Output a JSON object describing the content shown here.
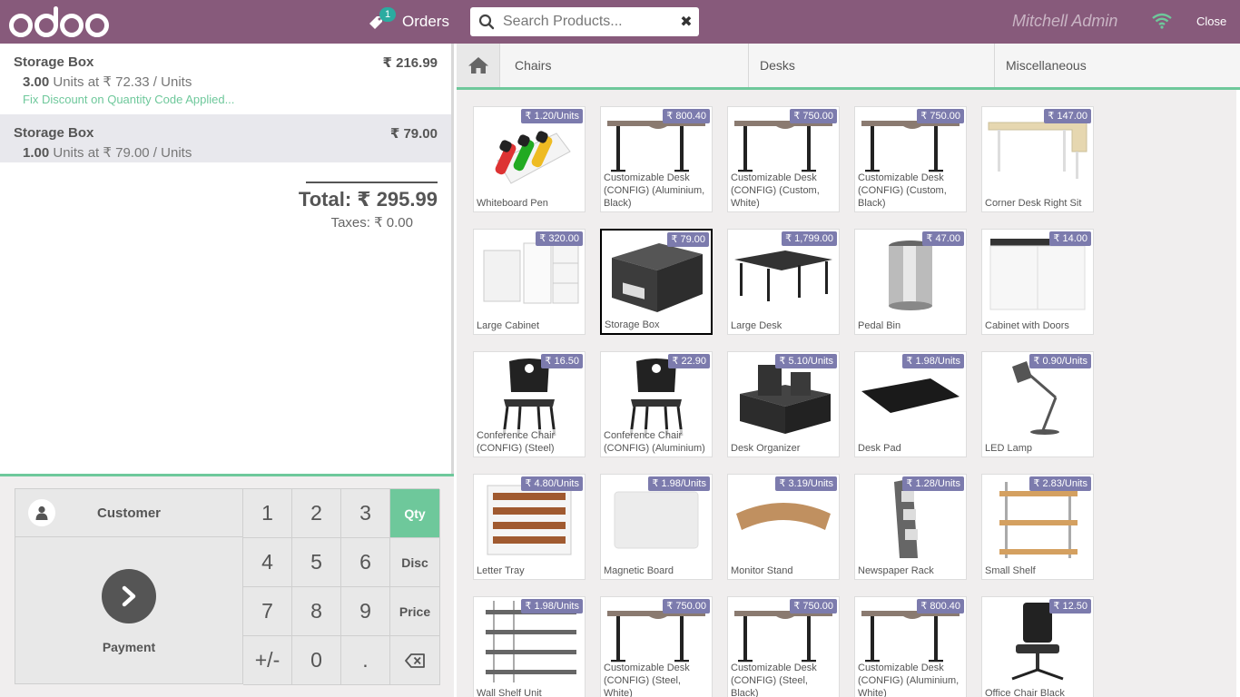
{
  "header": {
    "orders_label": "Orders",
    "orders_count": "1",
    "search_placeholder": "Search Products...",
    "user_name": "Mitchell Admin",
    "close_label": "Close"
  },
  "order": {
    "lines": [
      {
        "name": "Storage Box",
        "price": "₹ 216.99",
        "qty": "3.00",
        "unit_text": "Units at ₹ 72.33 / Units",
        "note": "Fix Discount on Quantity Code Applied..."
      },
      {
        "name": "Storage Box",
        "price": "₹ 79.00",
        "qty": "1.00",
        "unit_text": "Units at ₹ 79.00 / Units"
      }
    ],
    "total_label": "Total: ₹ 295.99",
    "taxes_label": "Taxes: ₹ 0.00"
  },
  "pad": {
    "customer_label": "Customer",
    "payment_label": "Payment",
    "keys": [
      "1",
      "2",
      "3",
      "Qty",
      "4",
      "5",
      "6",
      "Disc",
      "7",
      "8",
      "9",
      "Price",
      "+/-",
      "0",
      "."
    ],
    "active_mode": "Qty"
  },
  "categories": [
    "Chairs",
    "Desks",
    "Miscellaneous"
  ],
  "products": [
    {
      "name": "Whiteboard Pen",
      "price": "₹ 1.20/Units",
      "icon": "pen-icon"
    },
    {
      "name": "Customizable Desk (CONFIG) (Aluminium, Black)",
      "price": "₹ 800.40",
      "icon": "desk-icon"
    },
    {
      "name": "Customizable Desk (CONFIG) (Custom, White)",
      "price": "₹ 750.00",
      "icon": "desk-icon"
    },
    {
      "name": "Customizable Desk (CONFIG) (Custom, Black)",
      "price": "₹ 750.00",
      "icon": "desk-icon"
    },
    {
      "name": "Corner Desk Right Sit",
      "price": "₹ 147.00",
      "icon": "corner-desk-icon"
    },
    {
      "name": "Large Cabinet",
      "price": "₹ 320.00",
      "icon": "cabinet-icon"
    },
    {
      "name": "Storage Box",
      "price": "₹ 79.00",
      "icon": "box-icon"
    },
    {
      "name": "Large Desk",
      "price": "₹ 1,799.00",
      "icon": "large-desk-icon"
    },
    {
      "name": "Pedal Bin",
      "price": "₹ 47.00",
      "icon": "bin-icon"
    },
    {
      "name": "Cabinet with Doors",
      "price": "₹ 14.00",
      "icon": "cabinet-doors-icon"
    },
    {
      "name": "Conference Chair (CONFIG) (Steel)",
      "price": "₹ 16.50",
      "icon": "chair-icon"
    },
    {
      "name": "Conference Chair (CONFIG) (Aluminium)",
      "price": "₹ 22.90",
      "icon": "chair-icon"
    },
    {
      "name": "Desk Organizer",
      "price": "₹ 5.10/Units",
      "icon": "organizer-icon"
    },
    {
      "name": "Desk Pad",
      "price": "₹ 1.98/Units",
      "icon": "pad-icon"
    },
    {
      "name": "LED Lamp",
      "price": "₹ 0.90/Units",
      "icon": "lamp-icon"
    },
    {
      "name": "Letter Tray",
      "price": "₹ 4.80/Units",
      "icon": "tray-icon"
    },
    {
      "name": "Magnetic Board",
      "price": "₹ 1.98/Units",
      "icon": "board-icon"
    },
    {
      "name": "Monitor Stand",
      "price": "₹ 3.19/Units",
      "icon": "stand-icon"
    },
    {
      "name": "Newspaper Rack",
      "price": "₹ 1.28/Units",
      "icon": "rack-icon"
    },
    {
      "name": "Small Shelf",
      "price": "₹ 2.83/Units",
      "icon": "shelf-icon"
    },
    {
      "name": "Wall Shelf Unit",
      "price": "₹ 1.98/Units",
      "icon": "wall-shelf-icon"
    },
    {
      "name": "Customizable Desk (CONFIG) (Steel, White)",
      "price": "₹ 750.00",
      "icon": "desk-icon"
    },
    {
      "name": "Customizable Desk (CONFIG) (Steel, Black)",
      "price": "₹ 750.00",
      "icon": "desk-icon"
    },
    {
      "name": "Customizable Desk (CONFIG) (Aluminium, White)",
      "price": "₹ 800.40",
      "icon": "desk-icon"
    },
    {
      "name": "Office Chair Black",
      "price": "₹ 12.50",
      "icon": "office-chair-icon"
    }
  ],
  "colors": {
    "brand": "#875A7B",
    "accent": "#6ec89b",
    "price_tag": "#7c7bad",
    "badge": "#2baba0"
  }
}
